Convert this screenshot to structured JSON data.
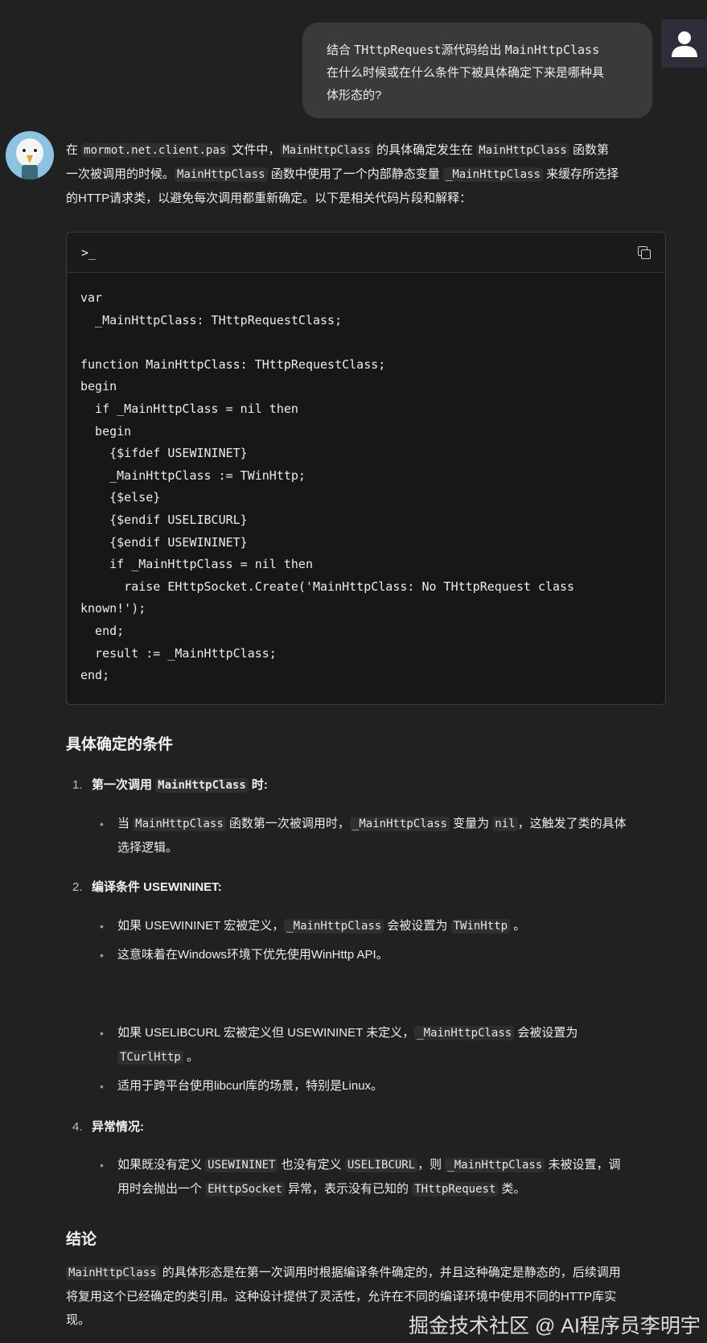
{
  "user_message": {
    "line1_a": "结合 ",
    "line1_code": "THttpRequest",
    "line1_b": "源代码给出 ",
    "line1_code2": "MainHttpClass",
    "line2": "在什么时候或在什么条件下被具体确定下来是哪种具",
    "line3": "体形态的?"
  },
  "intro": {
    "t1": "在 ",
    "c1": "mormot.net.client.pas",
    "t2": " 文件中，",
    "c2": "MainHttpClass",
    "t3": " 的具体确定发生在 ",
    "c3": "MainHttpClass",
    "t4": " 函数第",
    "t5": "一次被调用的时候。",
    "c4": "MainHttpClass",
    "t6": " 函数中使用了一个内部静态变量 ",
    "c5": "_MainHttpClass",
    "t7": " 来缓存所选择",
    "t8": "的HTTP请求类，以避免每次调用都重新确定。以下是相关代码片段和解释："
  },
  "code_block": {
    "prompt_icon": ">_",
    "code": "var\n  _MainHttpClass: THttpRequestClass;\n\nfunction MainHttpClass: THttpRequestClass;\nbegin\n  if _MainHttpClass = nil then\n  begin\n    {$ifdef USEWININET}\n    _MainHttpClass := TWinHttp;\n    {$else}\n    {$endif USELIBCURL}\n    {$endif USEWININET}\n    if _MainHttpClass = nil then\n      raise EHttpSocket.Create('MainHttpClass: No THttpRequest class\nknown!');\n  end;\n  result := _MainHttpClass;\nend;"
  },
  "section1": {
    "title": "具体确定的条件"
  },
  "item1": {
    "num": "1.",
    "label_a": "第一次调用 ",
    "label_code": "MainHttpClass",
    "label_b": " 时:",
    "b1": {
      "t1": "当 ",
      "c1": "MainHttpClass",
      "t2": " 函数第一次被调用时，",
      "c2": "_MainHttpClass",
      "t3": " 变量为 ",
      "c3": "nil",
      "t4": "，这触发了类的具体",
      "t5": "选择逻辑。"
    }
  },
  "item2": {
    "num": "2.",
    "label": "编译条件 USEWININET",
    "label_tail": ":",
    "b1": {
      "t1": "如果 USEWININET 宏被定义，",
      "c1": "_MainHttpClass",
      "t2": " 会被设置为 ",
      "c2": "TWinHttp",
      "t3": " 。"
    },
    "b2": {
      "t1": "这意味着在Windows环境下优先使用WinHttp API。"
    },
    "b3": {
      "t1": "如果 USELIBCURL 宏被定义但 USEWININET 未定义，",
      "c1": "_MainHttpClass",
      "t2": " 会被设置为",
      "c2": "TCurlHttp",
      "t3": " 。"
    },
    "b4": {
      "t1": "适用于跨平台使用libcurl库的场景，特别是Linux。"
    }
  },
  "item4": {
    "num": "4.",
    "label": "异常情况:",
    "b1": {
      "t1": "如果既没有定义 ",
      "c1": "USEWININET",
      "t2": " 也没有定义 ",
      "c2": "USELIBCURL",
      "t3": "，则 ",
      "c3": "_MainHttpClass",
      "t4": " 未被设置，调",
      "t5": "用时会抛出一个 ",
      "c4": "EHttpSocket",
      "t6": " 异常，表示没有已知的 ",
      "c5": "THttpRequest",
      "t7": " 类。"
    }
  },
  "section2": {
    "title": "结论"
  },
  "conclusion": {
    "c1": "MainHttpClass",
    "t1": " 的具体形态是在第一次调用时根据编译条件确定的，并且这种确定是静态的，后续调用",
    "t2": "将复用这个已经确定的类引用。这种设计提供了灵活性，允许在不同的编译环境中使用不同的HTTP库实",
    "t3": "现。"
  },
  "watermark": "掘金技术社区 @ AI程序员李明宇",
  "icons": {
    "user_avatar": "user-avatar-icon",
    "bot_avatar": "eagle-avatar-icon",
    "copy": "copy-icon",
    "terminal": "terminal-icon"
  }
}
